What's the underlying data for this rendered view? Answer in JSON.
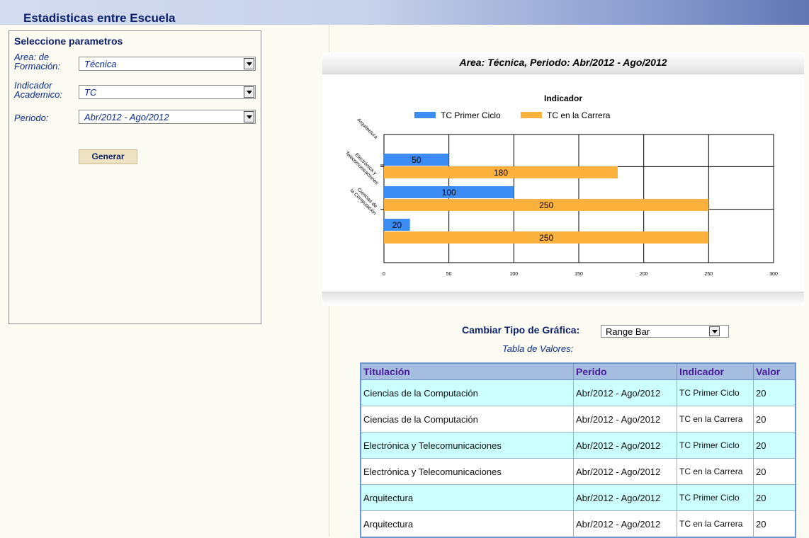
{
  "page": {
    "title": "Estadisticas entre Escuela"
  },
  "params": {
    "header": "Seleccione parametros",
    "area_label": "Area: de Formación:",
    "area_value": "Técnica",
    "indicador_label": "Indicador Academico:",
    "indicador_value": "TC",
    "periodo_label": "Periodo:",
    "periodo_value": "Abr/2012 - Ago/2012",
    "generate_label": "Generar"
  },
  "chart_header": "Area: Técnica, Periodo: Abr/2012 - Ago/2012",
  "chart_data": {
    "type": "bar",
    "orientation": "horizontal",
    "title": "Indicador",
    "categories": [
      "Arquitectura",
      "Electrónica y Telecomunicaciones",
      "Ciencias de la Computación"
    ],
    "series": [
      {
        "name": "TC Primer Ciclo",
        "color": "#3b8cf5",
        "values": [
          50,
          100,
          20
        ]
      },
      {
        "name": "TC en la Carrera",
        "color": "#fbb13c",
        "values": [
          180,
          250,
          250
        ]
      }
    ],
    "xlim": [
      0,
      300
    ],
    "ticks": [
      0,
      50,
      100,
      150,
      200,
      250,
      300
    ],
    "grid": true,
    "legend_position": "top"
  },
  "chart_type_selector": {
    "label": "Cambiar Tipo de Gráfica:",
    "value": "Range Bar"
  },
  "table": {
    "caption": "Tabla de Valores:",
    "headers": [
      "Titulación",
      "Perido",
      "Indicador",
      "Valor"
    ],
    "rows": [
      [
        "Ciencias de la Computación",
        "Abr/2012 - Ago/2012",
        "TC Primer Ciclo",
        "20"
      ],
      [
        "Ciencias de la Computación",
        "Abr/2012 - Ago/2012",
        "TC en la Carrera",
        "20"
      ],
      [
        "Electrónica y Telecomunicaciones",
        "Abr/2012 - Ago/2012",
        "TC Primer Ciclo",
        "20"
      ],
      [
        "Electrónica y Telecomunicaciones",
        "Abr/2012 - Ago/2012",
        "TC en la Carrera",
        "20"
      ],
      [
        "Arquitectura",
        "Abr/2012 - Ago/2012",
        "TC Primer Ciclo",
        "20"
      ],
      [
        "Arquitectura",
        "Abr/2012 - Ago/2012",
        "TC en la Carrera",
        "20"
      ]
    ]
  }
}
